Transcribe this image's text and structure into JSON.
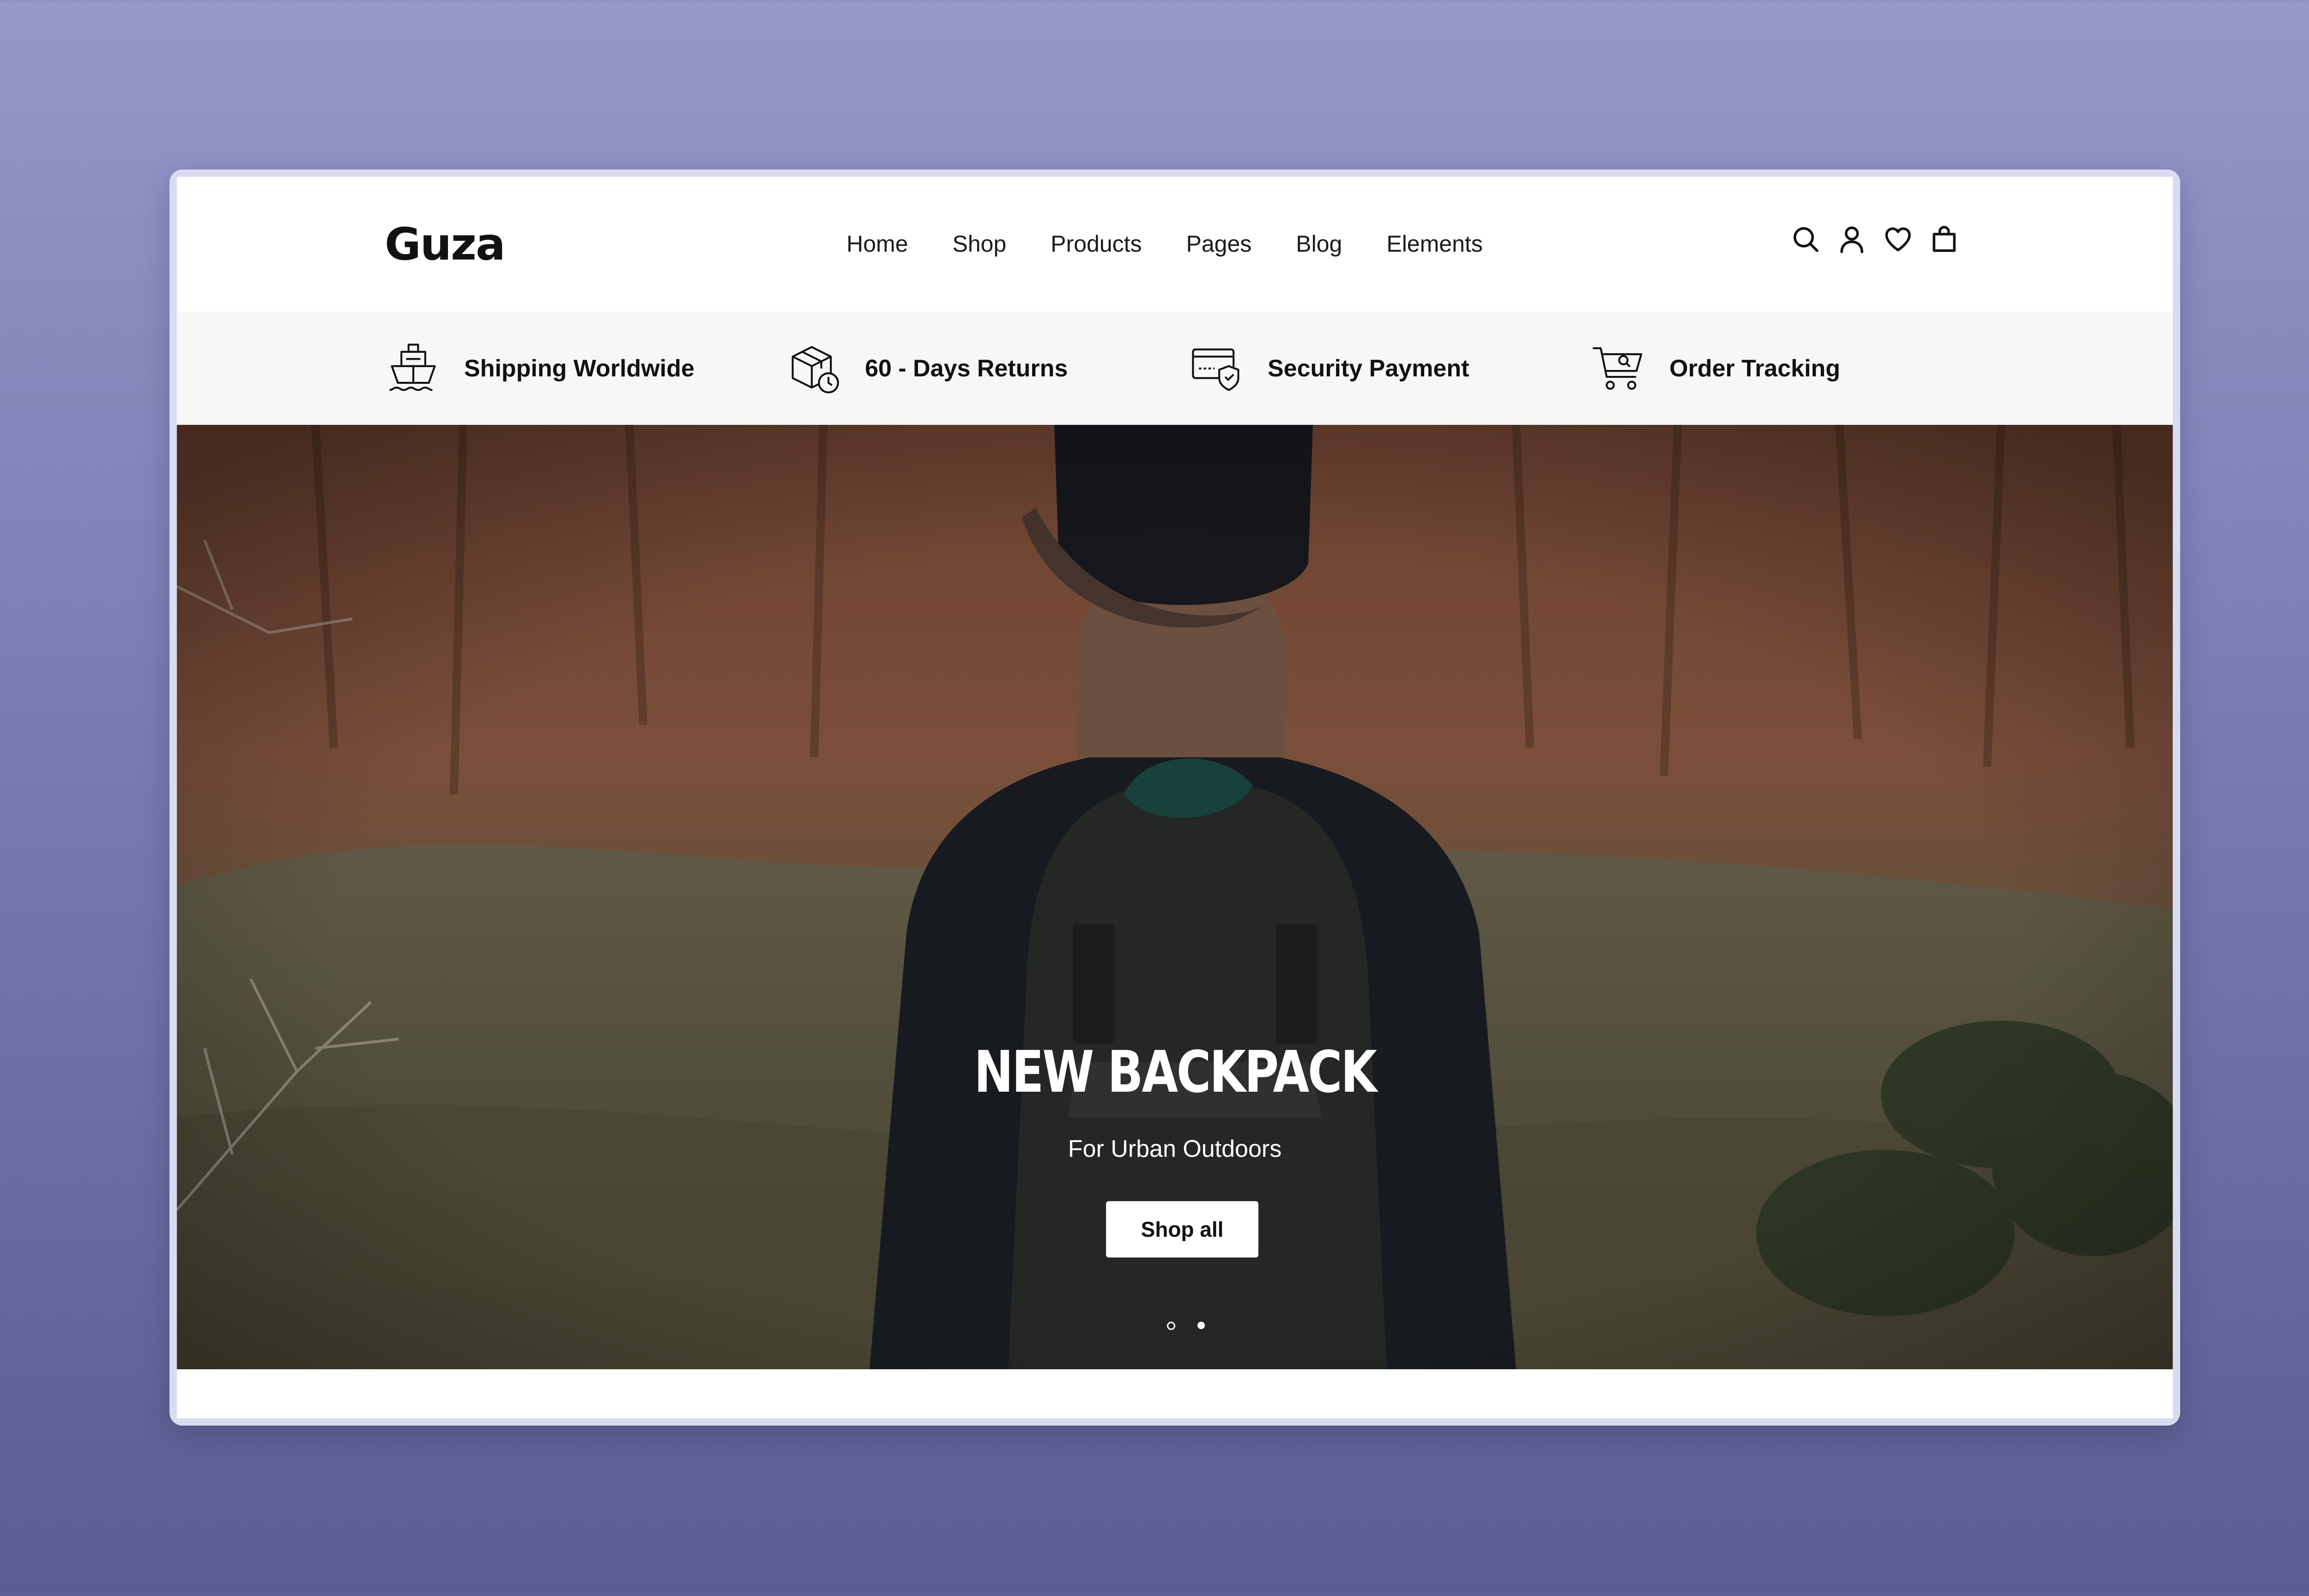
{
  "brand": {
    "logo": "Guza"
  },
  "nav": {
    "items": [
      "Home",
      "Shop",
      "Products",
      "Pages",
      "Blog",
      "Elements"
    ]
  },
  "header_icons": [
    "search-icon",
    "user-icon",
    "heart-icon",
    "bag-icon"
  ],
  "features": [
    {
      "label": "Shipping Worldwide",
      "icon": "ship-icon"
    },
    {
      "label": "60 - Days Returns",
      "icon": "box-clock-icon"
    },
    {
      "label": "Security Payment",
      "icon": "card-shield-icon"
    },
    {
      "label": "Order Tracking",
      "icon": "cart-search-icon"
    }
  ],
  "hero": {
    "title": "NEW BACKPACK",
    "subtitle": "For Urban Outdoors",
    "cta": "Shop all",
    "slides": {
      "count": 2,
      "active": 2
    }
  },
  "colors": {
    "background_top": "#9598c9",
    "background_bottom": "#5a5d91",
    "feature_bar": "#f7f7f7",
    "text_dark": "#111111",
    "button_bg": "#ffffff"
  }
}
